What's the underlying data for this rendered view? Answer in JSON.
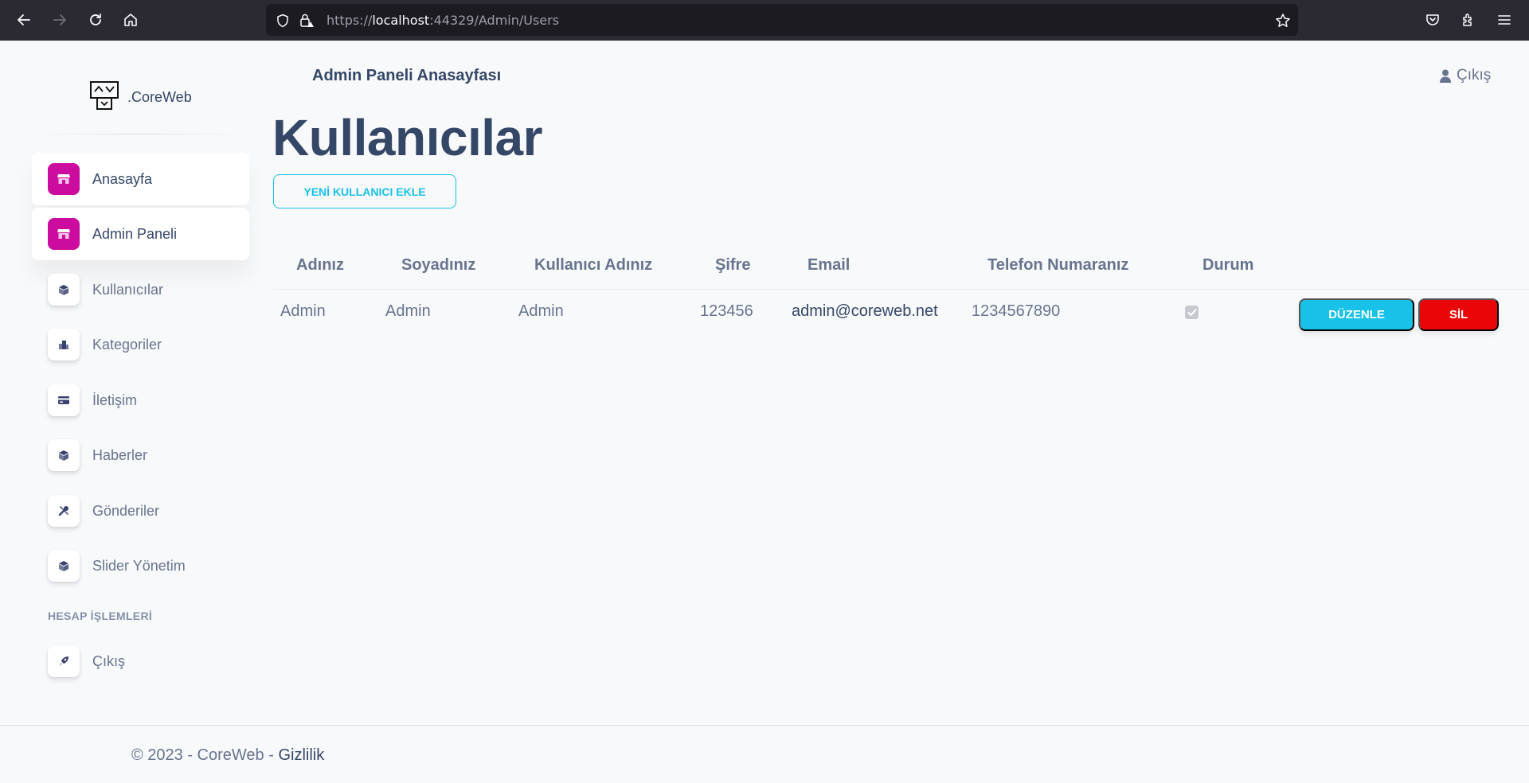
{
  "browser": {
    "url_scheme": "https://",
    "url_host": "localhost",
    "url_rest": ":44329/Admin/Users"
  },
  "brand": {
    "name": ".CoreWeb",
    "icon": "logo-icon"
  },
  "sidebar": {
    "items": [
      {
        "label": "Anasayfa",
        "icon": "shop-icon",
        "active": true
      },
      {
        "label": "Admin Paneli",
        "icon": "shop-icon",
        "active": true
      },
      {
        "label": "Kullanıcılar",
        "icon": "box-icon",
        "active": false
      },
      {
        "label": "Kategoriler",
        "icon": "office-icon",
        "active": false
      },
      {
        "label": "İletişim",
        "icon": "credit-card-icon",
        "active": false
      },
      {
        "label": "Haberler",
        "icon": "box-icon",
        "active": false
      },
      {
        "label": "Gönderiler",
        "icon": "settings-tools-icon",
        "active": false
      },
      {
        "label": "Slider Yönetim",
        "icon": "box-icon",
        "active": false
      }
    ],
    "section_title": "HESAP İŞLEMLERİ",
    "account_items": [
      {
        "label": "Çıkış",
        "icon": "rocket-icon"
      }
    ]
  },
  "header": {
    "title": "Admin Paneli Anasayfası",
    "logout_label": "Çıkış"
  },
  "main": {
    "page_title": "Kullanıcılar",
    "add_button": "YENİ KULLANICI EKLE",
    "columns": [
      "Adınız",
      "Soyadınız",
      "Kullanıcı Adınız",
      "Şifre",
      "Email",
      "Telefon Numaranız",
      "Durum"
    ],
    "rows": [
      {
        "first_name": "Admin",
        "last_name": "Admin",
        "username": "Admin",
        "password": "123456",
        "email": "admin@coreweb.net",
        "phone": "1234567890",
        "status_checked": true,
        "edit_label": "DÜZENLE",
        "delete_label": "SİL"
      }
    ]
  },
  "footer": {
    "text": "© 2023 - CoreWeb - ",
    "link": "Gizlilik"
  },
  "colors": {
    "accent": "#cb0c9f",
    "info": "#17c1e8",
    "danger": "#ea0606",
    "heading": "#344767",
    "text": "#67748e"
  }
}
